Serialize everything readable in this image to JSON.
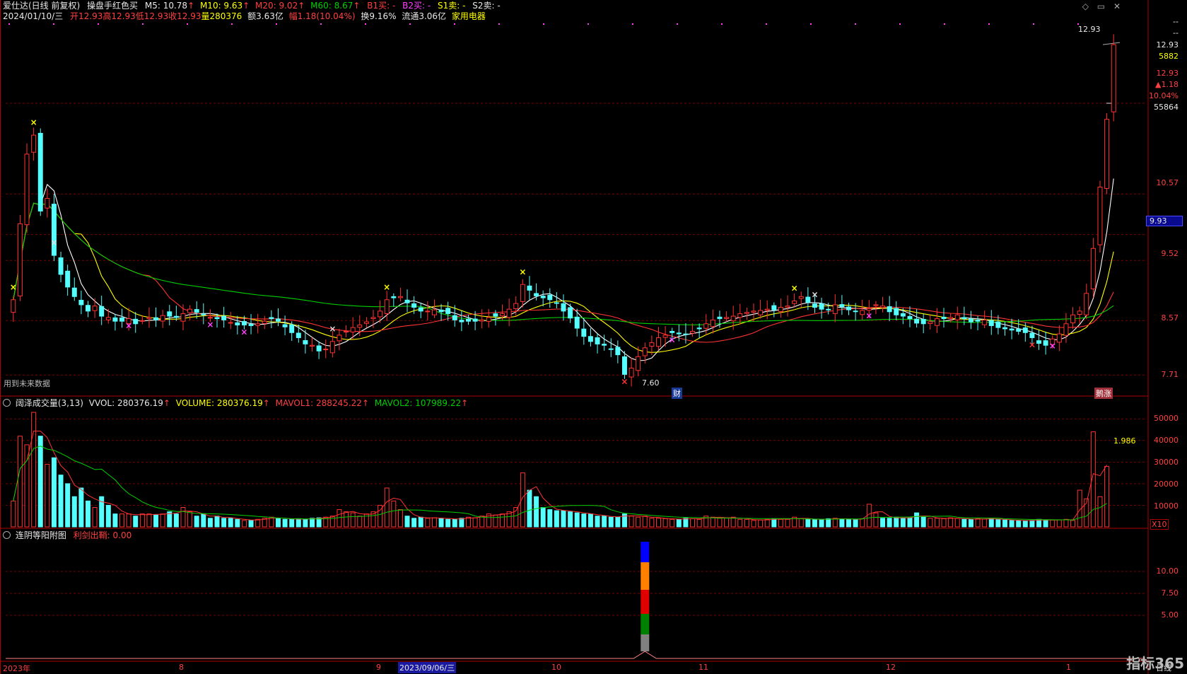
{
  "header": {
    "stock_name": "爱仕达(日线 前复权)",
    "indicator_name": "操盘手红色买",
    "ma5": "M5: 10.78",
    "ma10": "M10: 9.63",
    "ma20": "M20: 9.02",
    "ma60": "M60: 8.67",
    "b1": "B1买: -",
    "b2": "B2买: -",
    "s1": "S1卖: -",
    "s2": "S2卖: -",
    "date": "2024/01/10/三",
    "open": "开12.93",
    "high": "高12.93",
    "low": "低12.93",
    "close": "收12.93",
    "volume": "量280376",
    "amount": "额3.63亿",
    "change": "幅1.18(10.04%)",
    "turnover": "换9.16%",
    "float_cap": "流通3.06亿",
    "sector": "家用电器",
    "window_controls": "◇ ▭ ✕"
  },
  "right_panel": {
    "dash1": "--",
    "dash2": "--",
    "price": "12.93",
    "shares": "5882",
    "last_price": "12.93",
    "change_abs": "▲1.18",
    "change_pct": "10.04%",
    "volume": "55864"
  },
  "price_axis": [
    "10.57",
    "9.93",
    "9.52",
    "8.57",
    "7.71"
  ],
  "main_tags": {
    "future_data": "用到未来数据",
    "low_label": "7.60",
    "high_label": "12.93",
    "cai_badge": "财",
    "zhangting_badge": "鹅涨"
  },
  "volume_panel": {
    "title": "阔泽成交量(3,13)",
    "vvol": "VVOL: 280376.19",
    "volume": "VOLUME: 280376.19",
    "mavol1": "MAVOL1: 288245.22",
    "mavol2": "MAVOL2: 107989.22",
    "axis": [
      "50000",
      "40000",
      "30000",
      "20000",
      "10000"
    ],
    "unit": "X10",
    "ratio_label": "1.986"
  },
  "bottom_panel": {
    "title": "连阴等阳附图",
    "signal": "利剑出鞘: 0.00",
    "axis": [
      "10.00",
      "7.50",
      "5.00"
    ]
  },
  "time_axis": {
    "labels": [
      "2023年",
      "8",
      "9",
      "10",
      "11",
      "12",
      "1"
    ],
    "cursor_date": "2023/09/06/三",
    "period": "日线"
  },
  "brand": "指标365",
  "colors": {
    "up": "#ff3232",
    "down": "#54ffff",
    "ma5": "#ffffff",
    "ma10": "#ffff00",
    "ma20": "#ff3232",
    "ma60": "#00d000",
    "grid": "#7a0000"
  },
  "chart_data": {
    "type": "candlestick",
    "title": "爱仕达(日线 前复权)",
    "x_axis_labels": [
      "2023年",
      "8",
      "9",
      "10",
      "11",
      "12",
      "1"
    ],
    "y_axis_ticks": [
      10.57,
      9.93,
      9.52,
      8.57,
      7.71
    ],
    "ylim": [
      7.4,
      13.3
    ],
    "last_ohlc": {
      "open": 12.93,
      "high": 12.93,
      "low": 12.93,
      "close": 12.93
    },
    "closes": [
      8.9,
      10.1,
      11.2,
      11.5,
      10.3,
      10.5,
      9.6,
      9.3,
      9.1,
      8.95,
      8.82,
      8.72,
      8.8,
      8.64,
      8.62,
      8.56,
      8.56,
      8.6,
      8.52,
      8.57,
      8.62,
      8.58,
      8.65,
      8.64,
      8.62,
      8.68,
      8.75,
      8.7,
      8.66,
      8.62,
      8.6,
      8.58,
      8.54,
      8.5,
      8.5,
      8.49,
      8.52,
      8.56,
      8.6,
      8.56,
      8.47,
      8.38,
      8.3,
      8.2,
      8.18,
      8.09,
      8.12,
      8.24,
      8.34,
      8.4,
      8.46,
      8.5,
      8.55,
      8.62,
      8.72,
      8.9,
      8.93,
      8.95,
      8.85,
      8.78,
      8.72,
      8.72,
      8.74,
      8.71,
      8.68,
      8.58,
      8.55,
      8.56,
      8.56,
      8.58,
      8.62,
      8.64,
      8.68,
      8.75,
      8.84,
      9.14,
      9.05,
      8.96,
      8.93,
      8.9,
      8.85,
      8.72,
      8.61,
      8.45,
      8.32,
      8.24,
      8.2,
      8.18,
      8.12,
      8.03,
      7.72,
      7.82,
      8.0,
      8.14,
      8.22,
      8.3,
      8.34,
      8.38,
      8.36,
      8.35,
      8.4,
      8.44,
      8.52,
      8.58,
      8.6,
      8.62,
      8.64,
      8.68,
      8.7,
      8.72,
      8.73,
      8.75,
      8.74,
      8.78,
      8.8,
      8.88,
      8.95,
      8.86,
      8.78,
      8.75,
      8.74,
      8.82,
      8.79,
      8.74,
      8.72,
      8.73,
      8.76,
      8.82,
      8.8,
      8.71,
      8.66,
      8.64,
      8.6,
      8.53,
      8.52,
      8.55,
      8.6,
      8.6,
      8.62,
      8.66,
      8.6,
      8.55,
      8.56,
      8.58,
      8.49,
      8.46,
      8.44,
      8.42,
      8.4,
      8.38,
      8.3,
      8.21,
      8.18,
      8.28,
      8.36,
      8.52,
      8.66,
      8.72,
      9.0,
      9.71,
      10.68,
      11.75,
      12.93
    ],
    "series": [
      {
        "name": "M5",
        "value": 10.78
      },
      {
        "name": "M10",
        "value": 9.63
      },
      {
        "name": "M20",
        "value": 9.02
      },
      {
        "name": "M60",
        "value": 8.67
      }
    ],
    "volumes_x10": [
      12000,
      42000,
      38000,
      53000,
      42000,
      29000,
      32000,
      24000,
      20000,
      14000,
      18000,
      12000,
      9000,
      14000,
      10000,
      6000,
      6000,
      6000,
      5000,
      6000,
      6000,
      5500,
      6000,
      7000,
      6000,
      9000,
      7000,
      5000,
      6000,
      4000,
      5000,
      4000,
      4000,
      3500,
      3000,
      3000,
      3500,
      4000,
      4500,
      4000,
      3500,
      3500,
      3800,
      3500,
      4000,
      4200,
      4500,
      5000,
      8000,
      7000,
      6500,
      5000,
      6000,
      7000,
      10000,
      18000,
      12000,
      8000,
      5000,
      4000,
      4500,
      4000,
      4200,
      4000,
      3500,
      3600,
      4000,
      4500,
      4200,
      5000,
      6000,
      5500,
      6000,
      7000,
      9000,
      25000,
      17000,
      14000,
      9000,
      8000,
      7500,
      7500,
      7000,
      6500,
      6000,
      6000,
      5000,
      5000,
      4500,
      4500,
      6000,
      5000,
      4500,
      5000,
      4000,
      4000,
      3800,
      3500,
      3500,
      4000,
      3800,
      3500,
      5000,
      4500,
      4000,
      4200,
      4500,
      3500,
      3500,
      3000,
      3200,
      3500,
      3800,
      3500,
      3500,
      4500,
      3800,
      3500,
      3400,
      3500,
      3800,
      4000,
      3500,
      3600,
      3500,
      3800,
      10500,
      6500,
      4000,
      4000,
      4500,
      4000,
      4200,
      6500,
      4500,
      4000,
      4000,
      3800,
      4200,
      3900,
      3500,
      3500,
      3800,
      3600,
      3800,
      3500,
      3200,
      3000,
      3000,
      2800,
      3000,
      3500,
      3000,
      3200,
      3300,
      3500,
      3000,
      17000,
      13000,
      44000,
      14000,
      28000
    ],
    "mavol1_x10": [
      8000,
      20000,
      30000,
      45000,
      38000,
      32000,
      28000
    ],
    "mavol2_x10": [
      10000,
      23000,
      29000,
      28000
    ],
    "indicator_signal": {
      "label": "利剑出鞘",
      "value": 0.0,
      "peak_index": 93,
      "peak_value": 12.5
    }
  }
}
